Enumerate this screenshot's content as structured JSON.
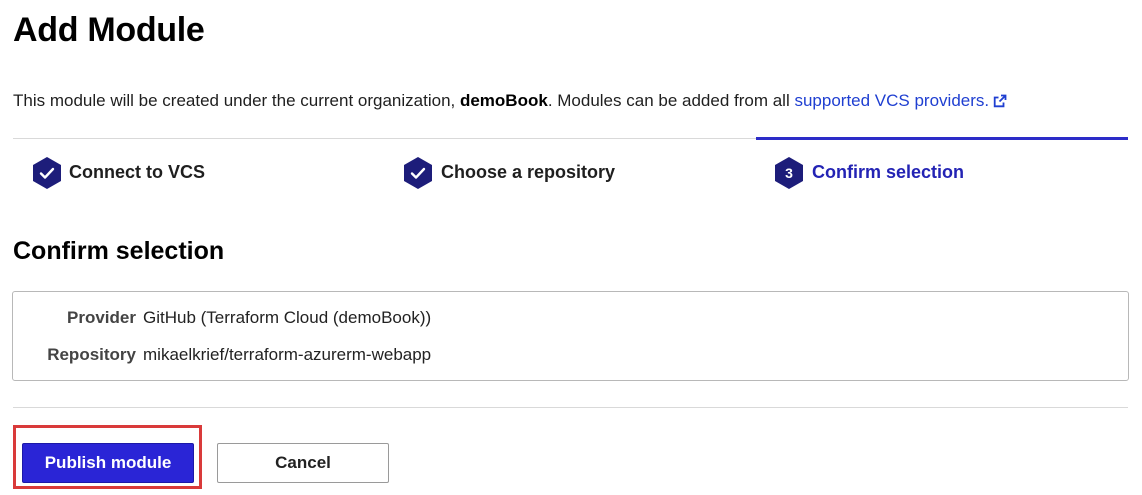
{
  "page": {
    "title": "Add Module",
    "intro_prefix": "This module will be created under the current organization, ",
    "organization": "demoBook",
    "intro_middle": ". Modules can be added from all ",
    "vcs_link": "supported VCS providers.",
    "external_link_icon": "external-link-icon"
  },
  "steps": [
    {
      "label": "Connect to VCS",
      "state": "complete",
      "icon": "check-icon"
    },
    {
      "label": "Choose a repository",
      "state": "complete",
      "icon": "check-icon"
    },
    {
      "label": "Confirm selection",
      "state": "active",
      "number": "3"
    }
  ],
  "confirm": {
    "heading": "Confirm selection",
    "rows": [
      {
        "key": "Provider",
        "value": "GitHub (Terraform Cloud (demoBook))"
      },
      {
        "key": "Repository",
        "value": "mikaelkrief/terraform-azurerm-webapp"
      }
    ]
  },
  "actions": {
    "publish_label": "Publish module",
    "cancel_label": "Cancel"
  },
  "colors": {
    "accent": "#2a25d6",
    "step_badge": "#1d1d7a",
    "link": "#1f3fd1",
    "highlight": "#d93a3a"
  }
}
